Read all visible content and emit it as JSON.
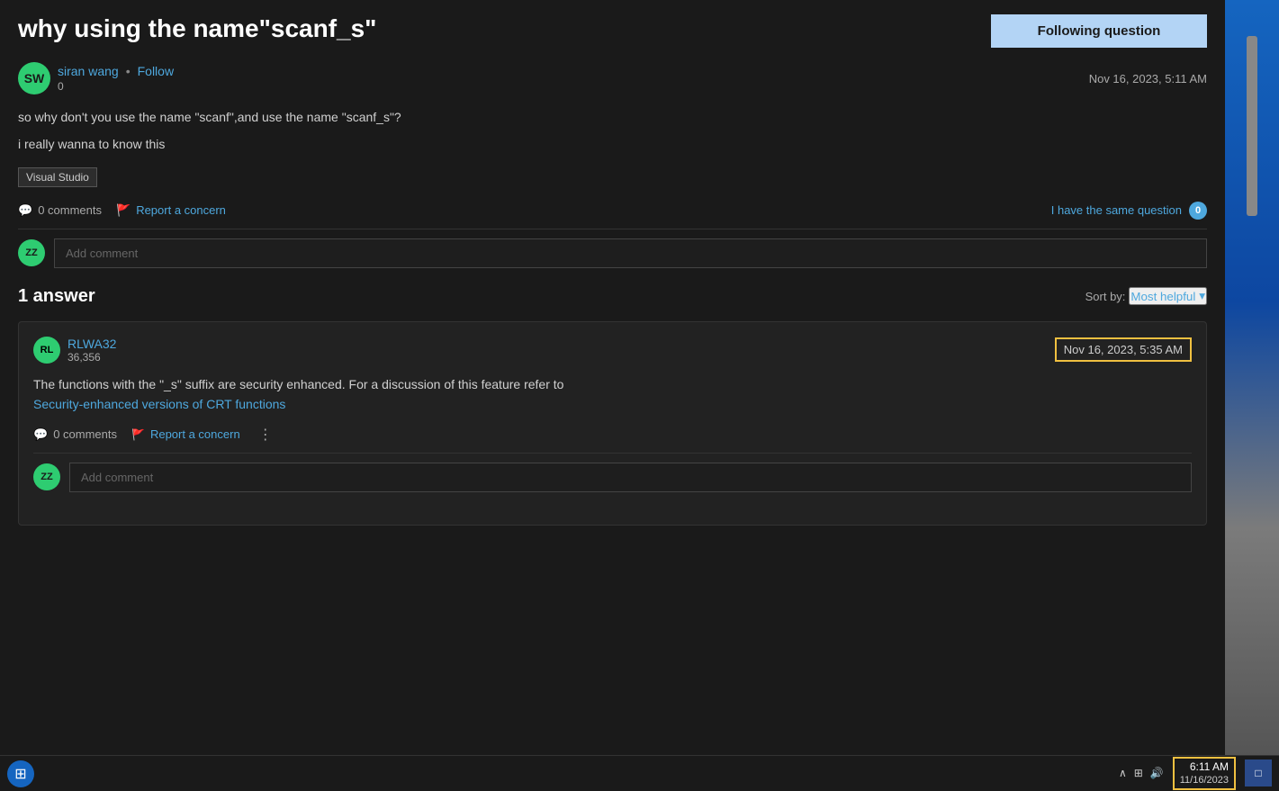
{
  "page": {
    "title": "why using the name\"scanf_s\""
  },
  "following_button": {
    "label": "Following question"
  },
  "question": {
    "title": "why using the name\"scanf_s\"",
    "author": {
      "initials": "SW",
      "name": "siran wang",
      "score": "0",
      "avatar_color": "#2ecc71"
    },
    "timestamp": "Nov 16, 2023, 5:11 AM",
    "body_line1": "so why don't you use the name \"scanf\",and use the name \"scanf_s\"?",
    "body_line2": "i really wanna to know this",
    "tag": "Visual Studio",
    "comments_count": "0 comments",
    "report_label": "Report a concern",
    "same_question_label": "I have the same question",
    "same_question_count": "0",
    "add_comment_placeholder": "Add comment"
  },
  "answers": {
    "title": "1 answer",
    "sort_by_label": "Sort by:",
    "sort_option": "Most helpful",
    "items": [
      {
        "author_initials": "RL",
        "author_name": "RLWA32",
        "author_score": "36,356",
        "timestamp": "Nov 16, 2023, 5:35 AM",
        "body_text": "The functions with the \"_s\" suffix are security enhanced. For a discussion of this feature refer to",
        "link_text": "Security-enhanced versions of CRT functions",
        "comments_count": "0 comments",
        "report_label": "Report a concern",
        "add_comment_placeholder": "Add comment"
      }
    ]
  },
  "taskbar": {
    "clock_time": "6:11 AM",
    "clock_date": "11/16/2023"
  },
  "user_avatar": {
    "initials": "ZZ",
    "color": "#2ecc71"
  }
}
